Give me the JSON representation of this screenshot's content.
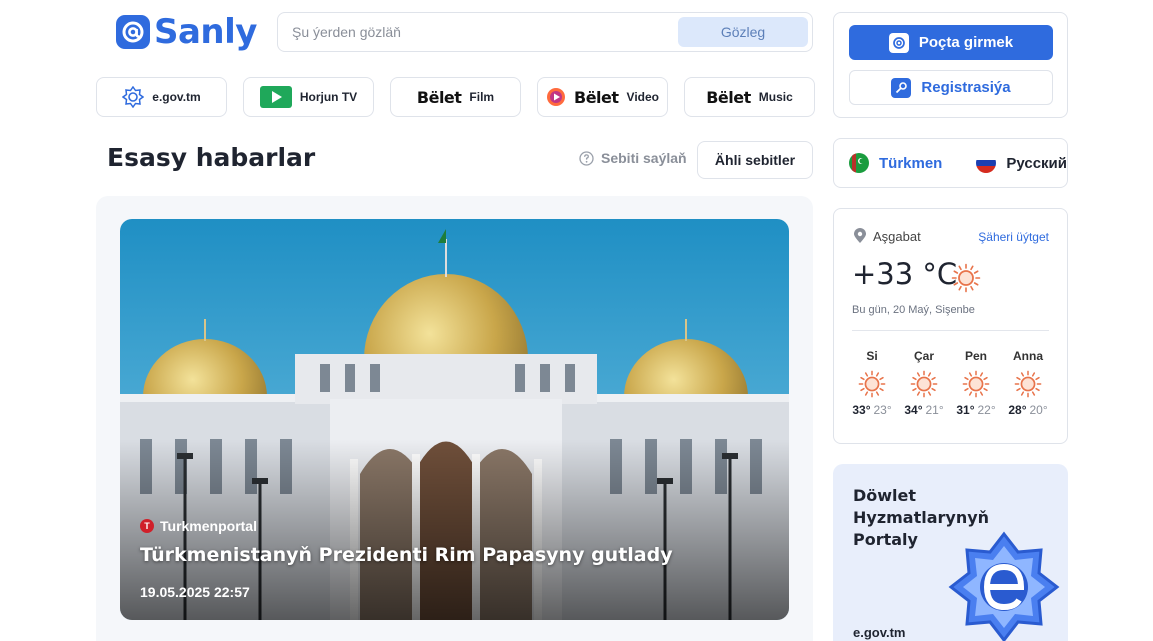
{
  "brand": {
    "name": "Sanly",
    "color": "#2f6bde"
  },
  "search": {
    "placeholder": "Şu ýerden gözläň",
    "value": "",
    "button_label": "Gözleg"
  },
  "services": [
    {
      "label": "e.gov.tm",
      "icon": "egov-icon"
    },
    {
      "label": "Horjun TV",
      "icon": "play-icon"
    },
    {
      "brand": "Bëlet",
      "label": "Film",
      "icon": "belet-film-logo"
    },
    {
      "brand": "Bëlet",
      "label": "Video",
      "icon": "belet-video-logo"
    },
    {
      "brand": "Bëlet",
      "label": "Music",
      "icon": "belet-music-logo"
    }
  ],
  "main": {
    "section_title": "Esasy habarlar",
    "region_select_label": "Sebiti saýlaň",
    "all_regions_label": "Ähli sebitler",
    "featured_news": {
      "source": "Turkmenportal",
      "headline": "Türkmenistanyň Prezidenti Rim Papasyny gutlady",
      "date": "19.05.2025 22:57"
    }
  },
  "auth": {
    "login_label": "Poçta girmek",
    "register_label": "Registrasiýa"
  },
  "languages": [
    {
      "label": "Türkmen",
      "active": true
    },
    {
      "label": "Русский",
      "active": false
    }
  ],
  "weather": {
    "city": "Aşgabat",
    "change_city_label": "Şäheri üýtget",
    "current_temp": "+33 °C",
    "date": "Bu gün, 20 Maý, Sişenbe",
    "forecast": [
      {
        "day": "Si",
        "high": "33°",
        "low": "23°",
        "icon": "sun-icon"
      },
      {
        "day": "Çar",
        "high": "34°",
        "low": "21°",
        "icon": "sun-icon"
      },
      {
        "day": "Pen",
        "high": "31°",
        "low": "22°",
        "icon": "sun-icon"
      },
      {
        "day": "Anna",
        "high": "28°",
        "low": "20°",
        "icon": "sun-icon"
      }
    ]
  },
  "egov_promo": {
    "title": "Döwlet Hyzmatlarynyň Portaly",
    "link": "e.gov.tm"
  },
  "colors": {
    "accent": "#2f6bde",
    "sun": "#e8734a",
    "promo_bg": "#e8eefb"
  }
}
